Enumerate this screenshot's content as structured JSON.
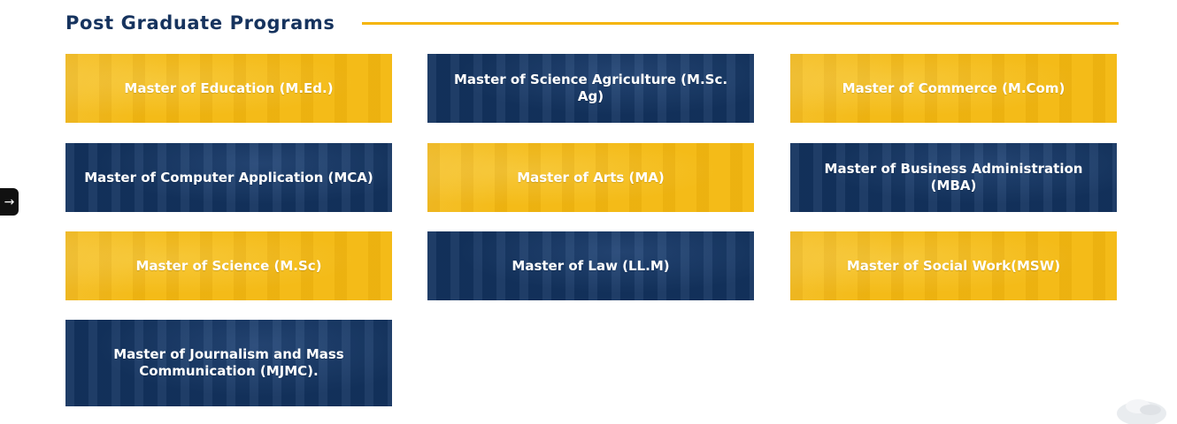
{
  "section": {
    "title": "Post Graduate Programs"
  },
  "programs": [
    {
      "label": "Master of Education (M.Ed.)",
      "theme": "yellow"
    },
    {
      "label": "Master of Science Agriculture (M.Sc. Ag)",
      "theme": "navy"
    },
    {
      "label": "Master of Commerce (M.Com)",
      "theme": "yellow"
    },
    {
      "label": "Master of Computer Application (MCA)",
      "theme": "navy"
    },
    {
      "label": "Master of Arts (MA)",
      "theme": "yellow"
    },
    {
      "label": "Master of Business Administration (MBA)",
      "theme": "navy"
    },
    {
      "label": "Master of Science (M.Sc)",
      "theme": "yellow"
    },
    {
      "label": "Master of Law (LL.M)",
      "theme": "navy"
    },
    {
      "label": "Master of Social Work(MSW)",
      "theme": "yellow"
    },
    {
      "label": "Master of Journalism and Mass Communication (MJMC).",
      "theme": "navy"
    }
  ],
  "side_tab": {
    "icon": "arrow-right-icon",
    "glyph": "→"
  },
  "chat_widget": {
    "icon": "chat-bubble-icon"
  },
  "colors": {
    "accent_yellow": "#f3b812",
    "brand_navy": "#13335f",
    "title_color": "#16335e",
    "line_color": "#f5b50a"
  }
}
